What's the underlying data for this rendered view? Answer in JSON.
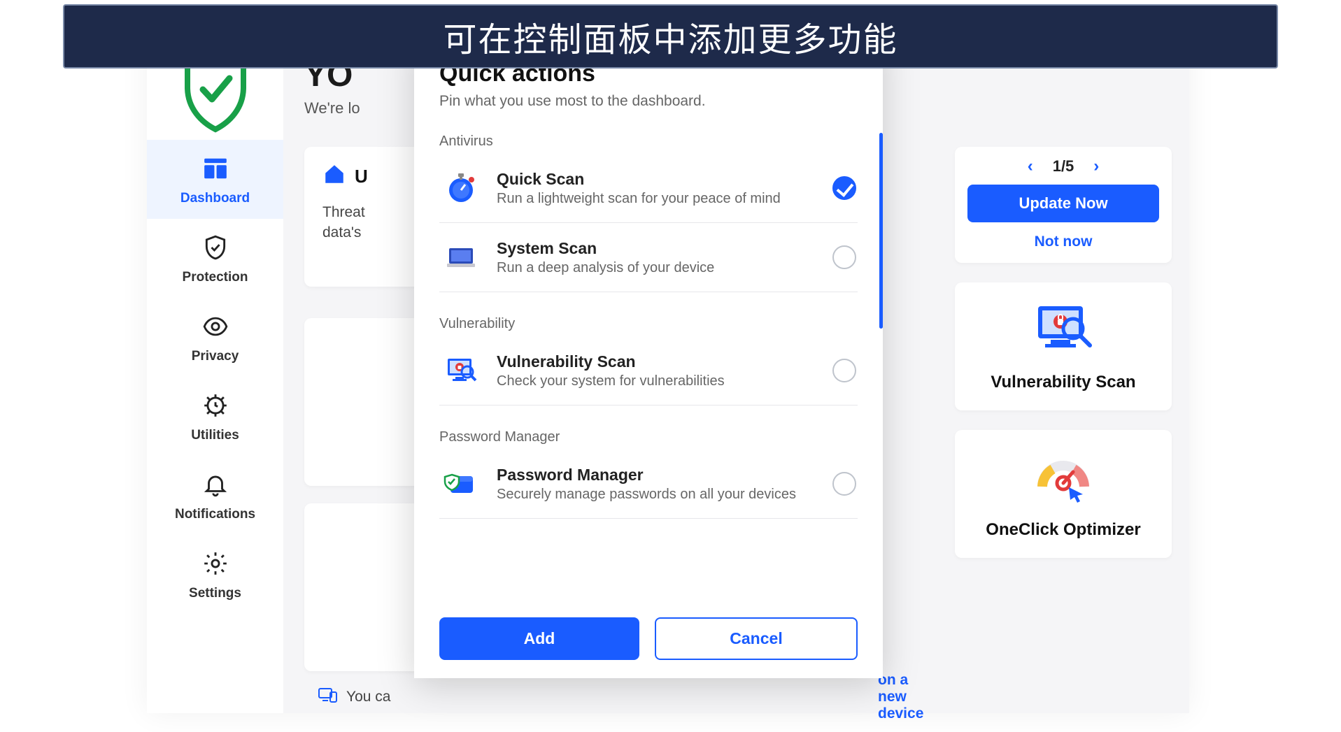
{
  "banner": {
    "text": "可在控制面板中添加更多功能"
  },
  "sidebar": {
    "items": [
      {
        "label": "Dashboard",
        "icon": "dashboard-icon",
        "active": true
      },
      {
        "label": "Protection",
        "icon": "shield-check-icon"
      },
      {
        "label": "Privacy",
        "icon": "eye-icon"
      },
      {
        "label": "Utilities",
        "icon": "gear-time-icon"
      },
      {
        "label": "Notifications",
        "icon": "bell-icon"
      },
      {
        "label": "Settings",
        "icon": "gear-icon"
      }
    ]
  },
  "header": {
    "title_fragment": "YO",
    "subtitle_fragment": "We're lo"
  },
  "left_cards": {
    "card1": {
      "title_fragment": "U",
      "desc_line1": "Threat",
      "desc_line2": "data's"
    }
  },
  "right_panel": {
    "pager": {
      "current": "1",
      "total": "5",
      "combined": "1/5"
    },
    "update_btn": "Update Now",
    "not_now": "Not now",
    "feature1": {
      "title": "Vulnerability Scan"
    },
    "feature2": {
      "title": "OneClick Optimizer"
    }
  },
  "bottom_hint": {
    "prefix": "You ca",
    "link_fragment": "on a new device"
  },
  "modal": {
    "title": "Quick actions",
    "subtitle": "Pin what you use most to the dashboard.",
    "sections": [
      {
        "label": "Antivirus",
        "items": [
          {
            "title": "Quick Scan",
            "desc": "Run a lightweight scan for your peace of mind",
            "checked": true,
            "icon": "stopwatch-icon"
          },
          {
            "title": "System Scan",
            "desc": "Run a deep analysis of your device",
            "checked": false,
            "icon": "laptop-scan-icon"
          }
        ]
      },
      {
        "label": "Vulnerability",
        "items": [
          {
            "title": "Vulnerability Scan",
            "desc": "Check your system for vulnerabilities",
            "checked": false,
            "icon": "monitor-lock-icon"
          }
        ]
      },
      {
        "label": "Password Manager",
        "items": [
          {
            "title": "Password Manager",
            "desc": "Securely manage passwords on all your devices",
            "checked": false,
            "icon": "wallet-shield-icon"
          }
        ]
      }
    ],
    "add_btn": "Add",
    "cancel_btn": "Cancel"
  },
  "colors": {
    "accent": "#1a5cff",
    "banner_bg": "#1e2a4a"
  }
}
